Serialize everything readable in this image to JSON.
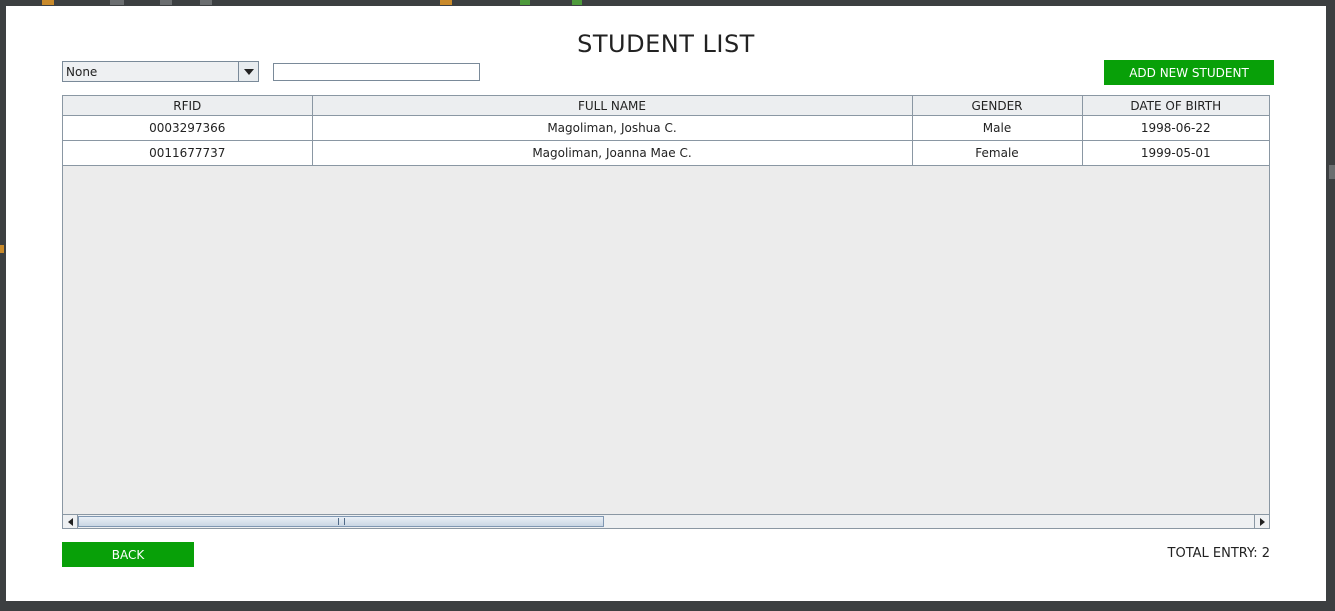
{
  "title": "STUDENT LIST",
  "filter": {
    "selected": "None",
    "search_value": ""
  },
  "buttons": {
    "add_label": "ADD NEW STUDENT",
    "back_label": "BACK"
  },
  "table": {
    "columns": [
      "RFID",
      "FULL NAME",
      "GENDER",
      "DATE OF BIRTH"
    ],
    "rows": [
      [
        "0003297366",
        "Magoliman, Joshua  C.",
        "Male",
        "1998-06-22"
      ],
      [
        "0011677737",
        "Magoliman, Joanna Mae C.",
        "Female",
        "1999-05-01"
      ]
    ]
  },
  "footer": {
    "total_label": "TOTAL ENTRY: 2"
  },
  "colors": {
    "accent_green": "#08a008",
    "grid_line": "#8a97a3",
    "table_bg": "#ececec"
  }
}
